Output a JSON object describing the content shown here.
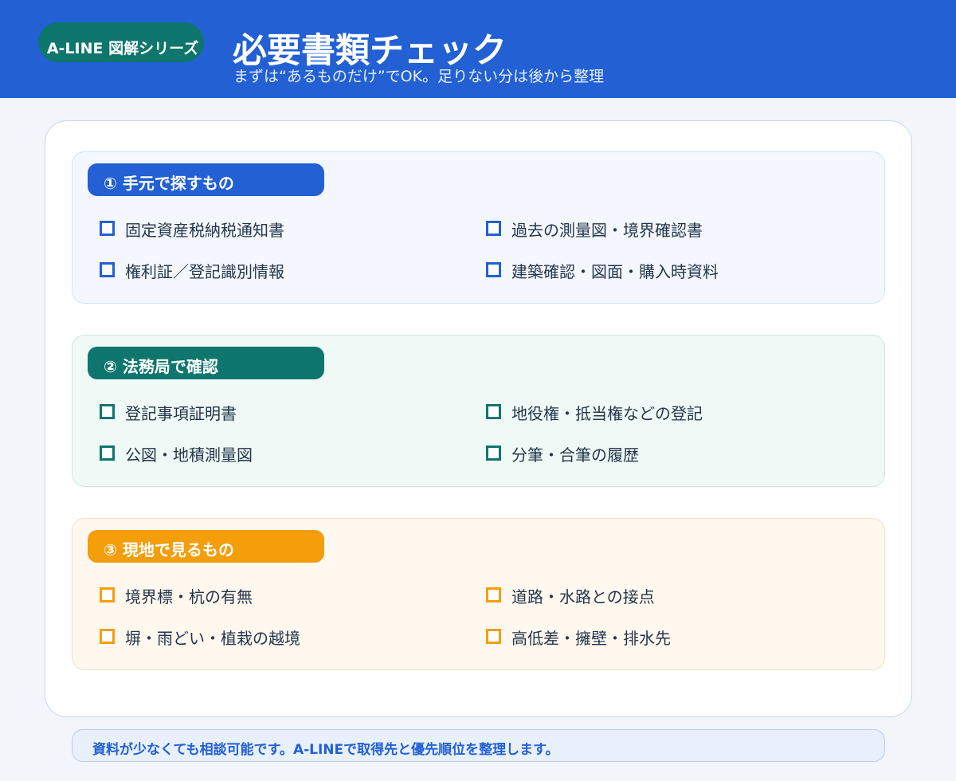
{
  "header": {
    "series_badge": "A-LINE 図解シリーズ",
    "title": "必要書類チェック",
    "subtitle": "まずは“あるものだけ”でOK。足りない分は後から整理",
    "background_color": "#2260d4",
    "badge_color": "#0f766e"
  },
  "sections": [
    {
      "title": "① 手元で探すもの",
      "accent_color": "#2260d4",
      "items": [
        "固定資産税納税通知書",
        "過去の測量図・境界確認書",
        "権利証／登記識別情報",
        "建築確認・図面・購入時資料"
      ]
    },
    {
      "title": "② 法務局で確認",
      "accent_color": "#0f766e",
      "items": [
        "登記事項証明書",
        "地役権・抵当権などの登記",
        "公図・地積測量図",
        "分筆・合筆の履歴"
      ]
    },
    {
      "title": "③ 現地で見るもの",
      "accent_color": "#f59e0b",
      "items": [
        "境界標・杭の有無",
        "道路・水路との接点",
        "塀・雨どい・植栽の越境",
        "高低差・擁壁・排水先"
      ]
    }
  ],
  "footer": {
    "note": "資料が少なくても相談可能です。A-LINEで取得先と優先順位を整理します。"
  }
}
